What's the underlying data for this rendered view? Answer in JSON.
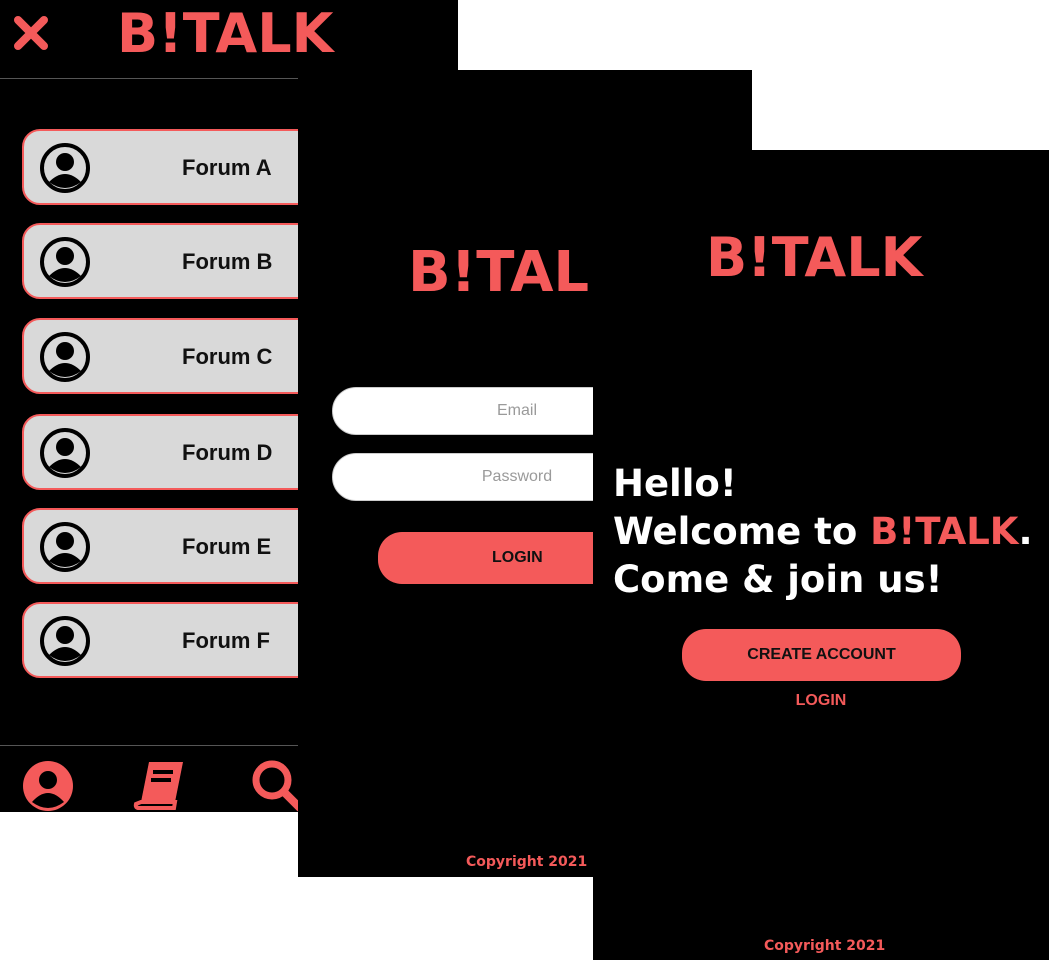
{
  "colors": {
    "accent": "#f45a5a",
    "background": "#000000",
    "card": "#d9d9d9"
  },
  "forum_screen": {
    "brand": "B!TALK",
    "close_icon": "close-icon",
    "forums": [
      {
        "label": "Forum A",
        "icon": "user-avatar-icon"
      },
      {
        "label": "Forum B",
        "icon": "user-avatar-icon"
      },
      {
        "label": "Forum C",
        "icon": "user-avatar-icon"
      },
      {
        "label": "Forum D",
        "icon": "user-avatar-icon"
      },
      {
        "label": "Forum E",
        "icon": "user-avatar-icon"
      },
      {
        "label": "Forum F",
        "icon": "user-avatar-icon"
      }
    ],
    "bottom_nav": [
      "profile-icon",
      "book-icon",
      "search-icon"
    ]
  },
  "login_screen": {
    "brand": "B!TALK",
    "email_placeholder": "Email",
    "password_placeholder": "Password",
    "login_label": "LOGIN",
    "copyright": "Copyright 2021"
  },
  "welcome_screen": {
    "brand": "B!TALK",
    "hello_line1": "Hello!",
    "hello_line2_prefix": "Welcome to ",
    "hello_line2_brand": "B!TALK",
    "hello_line2_suffix": ".",
    "hello_line3": "Come & join us!",
    "create_account_label": "CREATE ACCOUNT",
    "login_label": "LOGIN",
    "copyright": "Copyright 2021"
  }
}
